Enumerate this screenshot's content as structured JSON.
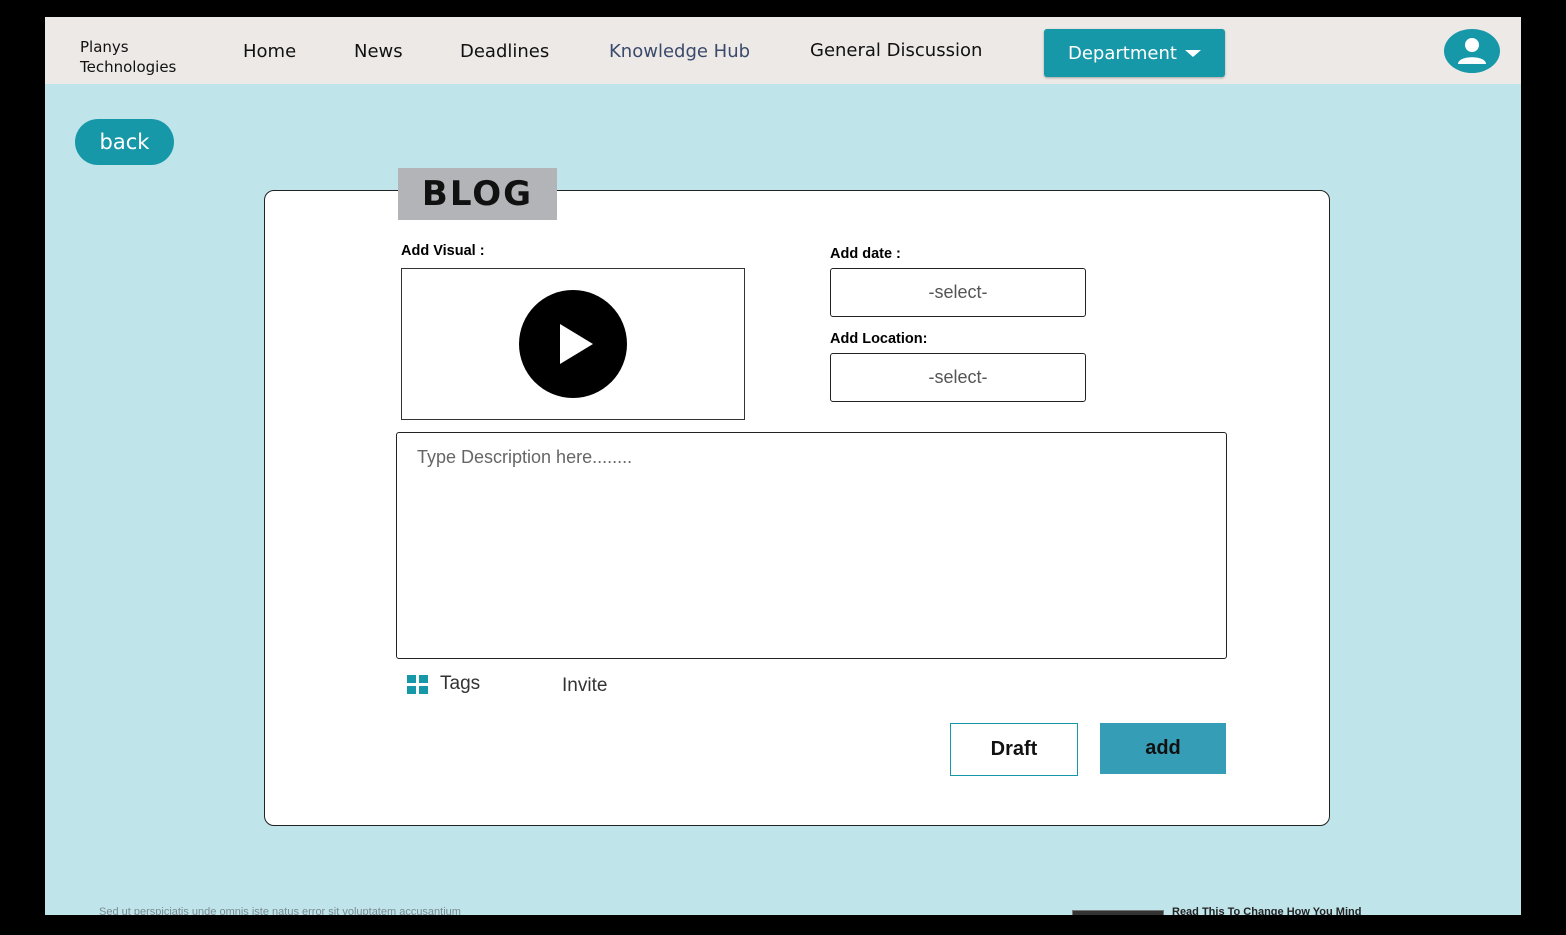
{
  "brand": {
    "line1": "Planys",
    "line2": "Technologies"
  },
  "nav": {
    "home": "Home",
    "news": "News",
    "deadlines": "Deadlines",
    "knowledge_hub": "Knowledge Hub",
    "general_discussion": "General Discussion",
    "department": "Department"
  },
  "back_label": "back",
  "blog": {
    "title": "BLOG",
    "add_visual_label": "Add Visual :",
    "add_date_label": "Add date :",
    "date_value": "-select-",
    "add_location_label": "Add Location:",
    "location_value": "-select-",
    "description_placeholder": "Type  Description here........",
    "tags_label": "Tags",
    "invite_label": "Invite",
    "draft_label": "Draft",
    "add_label": "add"
  },
  "footer": {
    "text": "Sed ut perspiciatis unde omnis iste natus error sit voluptatem accusantium",
    "article_title": "Read This To Change How You Mind"
  },
  "colors": {
    "accent": "#1798a8",
    "background": "#bfe4ea",
    "topbar": "#ede9e7",
    "tab": "#b3b4b7"
  },
  "icons": {
    "avatar": "user-icon",
    "play": "play-icon",
    "tags": "plus-icon",
    "department": "caret-down-icon"
  }
}
